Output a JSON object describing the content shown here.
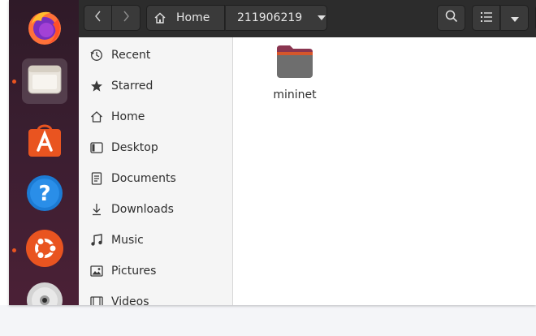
{
  "colors": {
    "accent": "#e95420",
    "folder_top": "#8a3550",
    "folder_body": "#6e6e6e"
  },
  "dock": {
    "items": [
      {
        "name": "firefox",
        "icon": "firefox-icon"
      },
      {
        "name": "files",
        "icon": "files-icon",
        "active": true
      },
      {
        "name": "software",
        "icon": "ubuntu-software-icon"
      },
      {
        "name": "help",
        "icon": "help-icon"
      },
      {
        "name": "ubuntu",
        "icon": "ubuntu-logo-icon"
      },
      {
        "name": "disc",
        "icon": "cd-icon"
      }
    ]
  },
  "header": {
    "path": {
      "home_label": "Home",
      "current_dir": "211906219"
    }
  },
  "sidebar": {
    "items": [
      {
        "label": "Recent",
        "icon": "clock-icon"
      },
      {
        "label": "Starred",
        "icon": "star-icon"
      },
      {
        "label": "Home",
        "icon": "home-icon"
      },
      {
        "label": "Desktop",
        "icon": "desktop-icon"
      },
      {
        "label": "Documents",
        "icon": "document-icon"
      },
      {
        "label": "Downloads",
        "icon": "download-icon"
      },
      {
        "label": "Music",
        "icon": "music-icon"
      },
      {
        "label": "Pictures",
        "icon": "picture-icon"
      },
      {
        "label": "Videos",
        "icon": "video-icon"
      }
    ]
  },
  "content": {
    "files": [
      {
        "name": "mininet",
        "type": "folder"
      }
    ]
  }
}
